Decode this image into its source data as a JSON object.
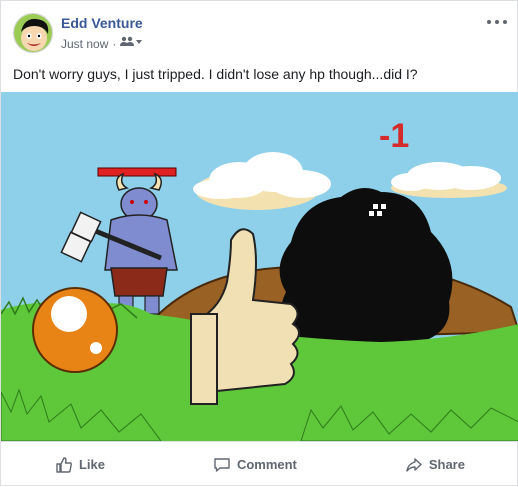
{
  "post": {
    "author": "Edd Venture",
    "timestamp": "Just now",
    "audience_icon": "friends-icon",
    "message": "Don't worry guys, I just tripped. I didn't lose any hp though...did I?",
    "image": {
      "damage_text": "-1",
      "description_icons": [
        "minotaur-icon",
        "thumbs-up-icon",
        "shadow-creature-icon",
        "orb-icon"
      ]
    }
  },
  "actions": {
    "like_label": "Like",
    "comment_label": "Comment",
    "share_label": "Share"
  },
  "colors": {
    "name_link": "#385898",
    "meta_text": "#606770",
    "sky": "#8ed0ea",
    "grass": "#5ec83a",
    "damage_red": "#d42a2a"
  }
}
